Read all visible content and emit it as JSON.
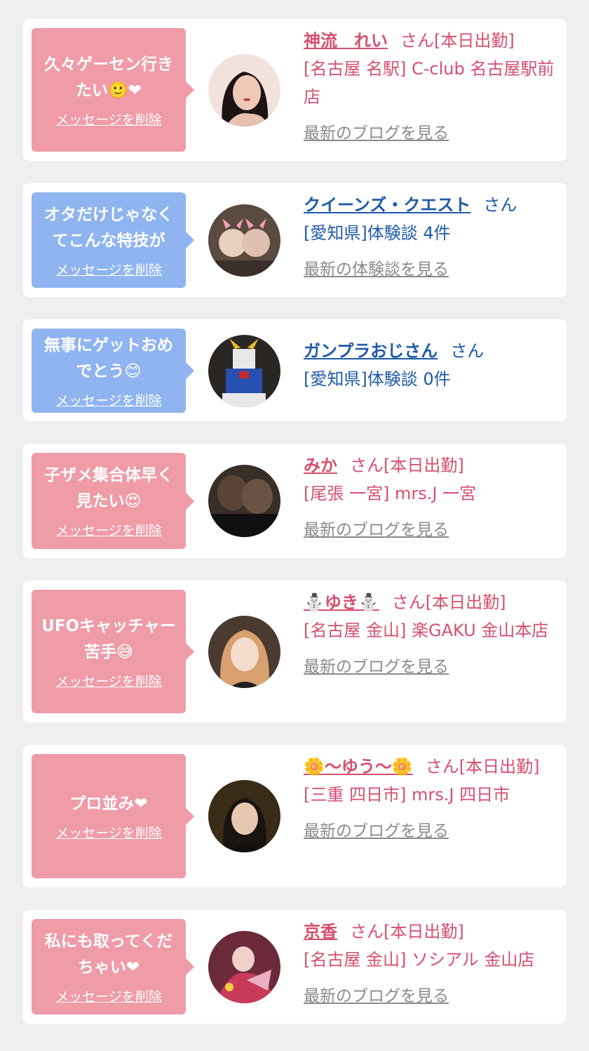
{
  "delete_label": "メッセージを削除",
  "colors": {
    "pink_bubble": "#ef9ba8",
    "blue_bubble": "#8fb4f0",
    "pink_text": "#d64f6e",
    "blue_text": "#1f59a8"
  },
  "cards": [
    {
      "message": "久々ゲーセン行き\nたい🙂❤",
      "name": "神流　れい",
      "suffix": "さん[本日出勤]",
      "location": "[名古屋 名駅] C-club 名古屋駅前店",
      "link": "最新のブログを見る",
      "avatar_icon": "woman-portrait"
    },
    {
      "message": "オタだけじゃなく\nてこんな特技が",
      "name": "クイーンズ・クエスト",
      "suffix": "さん",
      "location": "[愛知県]体験談 4件",
      "link": "最新の体験談を見る",
      "avatar_icon": "plush-dolls"
    },
    {
      "message": "無事にゲットおめ\nでとう😊",
      "name": "ガンプラおじさん",
      "suffix": "さん",
      "location": "[愛知県]体験談 0件",
      "link": "",
      "avatar_icon": "gundam-robot"
    },
    {
      "message": "子ザメ集合体早く\n見たい😍",
      "name": "みか",
      "suffix": "さん[本日出勤]",
      "location": "[尾張 一宮] mrs.J 一宮",
      "link": "最新のブログを見る",
      "avatar_icon": "stockings-photo"
    },
    {
      "message": "UFOキャッチャー\n苦手😅",
      "name": "⛄ゆき⛄",
      "suffix": "さん[本日出勤]",
      "location": "[名古屋 金山] 楽GAKU 金山本店",
      "link": "最新のブログを見る",
      "avatar_icon": "woman-portrait"
    },
    {
      "message": "プロ並み❤",
      "name": "🌼〜ゆう〜🌼",
      "suffix": "さん[本日出勤]",
      "location": "[三重 四日市] mrs.J 四日市",
      "link": "最新のブログを見る",
      "avatar_icon": "woman-portrait"
    },
    {
      "message": "私にも取ってくだ\nちゃい❤",
      "name": "京香",
      "suffix": "さん[本日出勤]",
      "location": "[名古屋 金山] ソシアル 金山店",
      "link": "最新のブログを見る",
      "avatar_icon": "kimono-woman"
    }
  ]
}
